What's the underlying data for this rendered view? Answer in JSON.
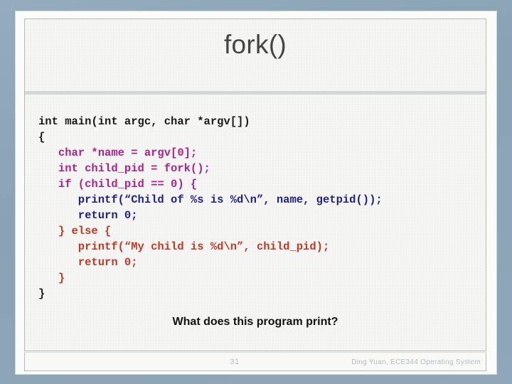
{
  "slide": {
    "title": "fork()",
    "question": "What does this program print?",
    "slide_number": "31",
    "credit": "Ding Yuan, ECE344 Operating System"
  },
  "colors": {
    "mat": "#8ba4b5",
    "page": "#fbfbfa",
    "content": "#f6f6f4",
    "title_text": "#444444",
    "rule": "#d2d6d6",
    "code_black": "#1a1a1a",
    "code_purple": "#a8248c",
    "code_blue": "#202088",
    "code_red": "#bf3a27",
    "footer_text": "#b6bcc2"
  },
  "code": {
    "language": "c",
    "lines": [
      {
        "text": "int main(int argc, char *argv[])",
        "color": "black"
      },
      {
        "text": "{",
        "color": "black"
      },
      {
        "text": "   char *name = argv[0];",
        "color": "purple"
      },
      {
        "text": "   int child_pid = fork();",
        "color": "purple"
      },
      {
        "text": "   if (child_pid == 0) {",
        "color": "purple"
      },
      {
        "text": "      printf(“Child of %s is %d\\n”, name, getpid());",
        "color": "blue"
      },
      {
        "text": "      return 0;",
        "color": "blue"
      },
      {
        "text": "   } else {",
        "color": "red"
      },
      {
        "text": "      printf(“My child is %d\\n”, child_pid);",
        "color": "red"
      },
      {
        "text": "      return 0;",
        "color": "red"
      },
      {
        "text": "   }",
        "color": "red"
      },
      {
        "text": "}",
        "color": "black"
      }
    ]
  }
}
